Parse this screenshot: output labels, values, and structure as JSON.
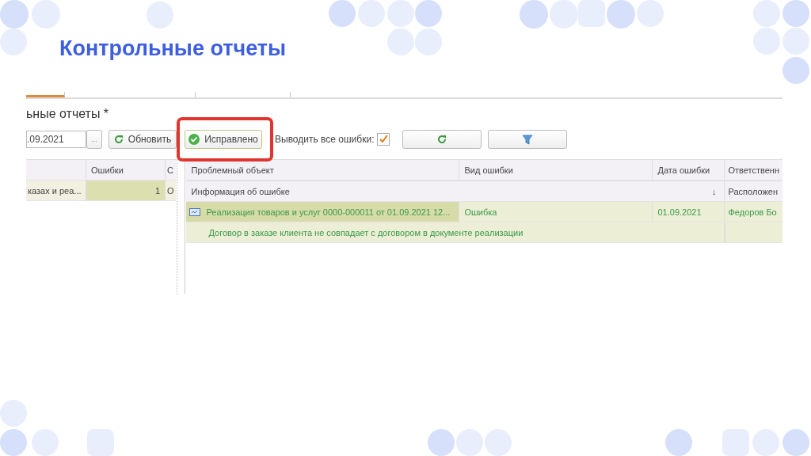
{
  "slide": {
    "title": "Контрольные отчеты"
  },
  "window": {
    "tabs": [
      {
        "selected": true
      },
      {
        "selected": false
      },
      {
        "selected": false
      }
    ],
    "form_title": "ьные отчеты *",
    "toolbar": {
      "date_field": ".09.2021",
      "select_button": "...",
      "refresh_button": "Обновить",
      "fixed_button": {
        "label": "Исправлено",
        "highlighted": true
      },
      "show_all_label": "Выводить все ошибки:",
      "show_all_checked": true
    },
    "left_table": {
      "columns": [
        "",
        "Ошибки",
        "С"
      ],
      "rows": [
        {
          "cells": [
            "казах и реа...",
            "1",
            "О"
          ],
          "selected": true
        }
      ]
    },
    "right_table": {
      "columns": [
        "Проблемный объект",
        "Вид ошибки",
        "Дата ошибки",
        "Ответственн"
      ],
      "subheader": {
        "info": "Информация об ошибке",
        "sort_mark": "↓",
        "location": "Расположен"
      },
      "rows": [
        {
          "cells": [
            "Реализация товаров и услуг 0000-000011 от 01.09.2021 12...",
            "Ошибка",
            "01.09.2021",
            "Федоров Бо"
          ],
          "selected": true,
          "detail": "Договор в заказе клиента не совпадает с договором в документе реализации"
        }
      ]
    }
  }
}
